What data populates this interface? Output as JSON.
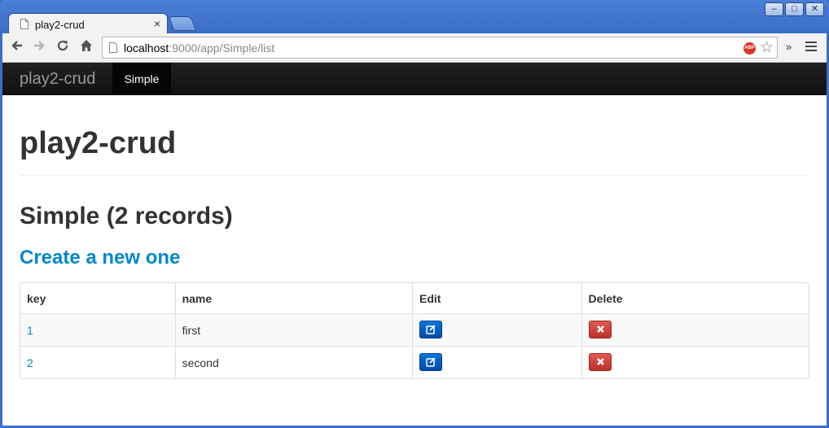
{
  "browser": {
    "tab_title": "play2-crud",
    "tab_close": "×",
    "url_host": "localhost",
    "url_rest": ":9000/app/Simple/list",
    "abp_label": "ABP",
    "overflow_chevron": "»",
    "window_controls": {
      "minimize": "–",
      "maximize": "□",
      "close": "✕"
    }
  },
  "navbar": {
    "brand": "play2-crud",
    "links": [
      {
        "label": "Simple",
        "active": true
      }
    ]
  },
  "page": {
    "title": "play2-crud",
    "section_title": "Simple (2 records)",
    "create_link": "Create a new one"
  },
  "table": {
    "headers": [
      "key",
      "name",
      "Edit",
      "Delete"
    ],
    "rows": [
      {
        "key": "1",
        "name": "first"
      },
      {
        "key": "2",
        "name": "second"
      }
    ]
  },
  "colors": {
    "link": "#0088cc",
    "edit_button": "#0055cc",
    "delete_button": "#cc3a33",
    "navbar": "#1b1b1b"
  },
  "icons": {
    "edit": "edit-icon",
    "delete": "delete-icon"
  }
}
